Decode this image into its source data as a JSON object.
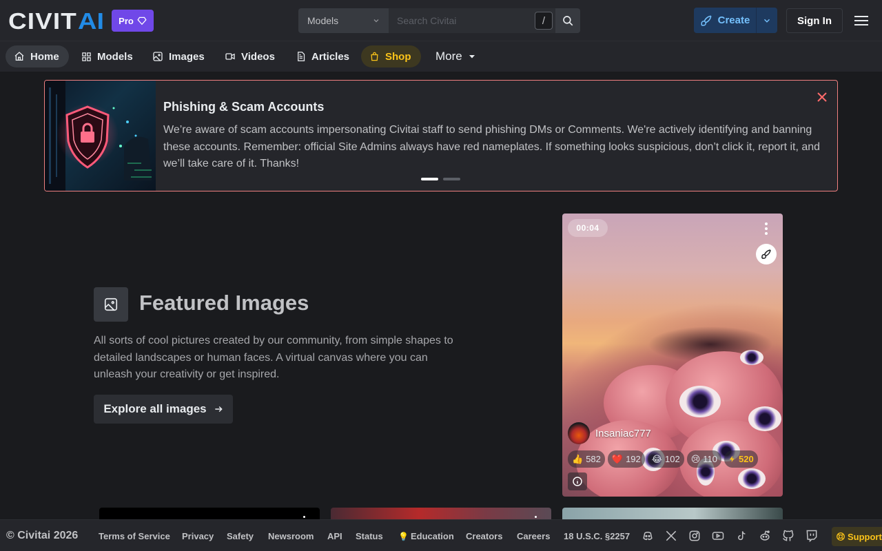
{
  "header": {
    "logo_text": "CIVITAI",
    "pro_label": "Pro",
    "search": {
      "category": "Models",
      "placeholder": "Search Civitai",
      "shortcut": "/"
    },
    "create_label": "Create",
    "signin_label": "Sign In"
  },
  "nav": {
    "items": [
      {
        "label": "Home",
        "icon": "home-icon"
      },
      {
        "label": "Models",
        "icon": "grid-icon"
      },
      {
        "label": "Images",
        "icon": "image-icon"
      },
      {
        "label": "Videos",
        "icon": "video-icon"
      },
      {
        "label": "Articles",
        "icon": "article-icon"
      },
      {
        "label": "Shop",
        "icon": "shopping-bag-icon"
      },
      {
        "label": "More",
        "icon": "caret-down-icon"
      }
    ]
  },
  "announcement": {
    "title": "Phishing & Scam Accounts",
    "body": "We’re aware of scam accounts impersonating Civitai staff to send phishing DMs or Comments. We're actively identifying and banning these accounts. Remember: official Site Admins always have red nameplates. If something looks suspicious, don’t click it, report it, and we’ll take care of it. Thanks!",
    "slide_count": 2,
    "active_slide": 1
  },
  "featured": {
    "title": "Featured Images",
    "description": "All sorts of cool pictures created by our community, from simple shapes to detailed landscapes or human faces. A virtual canvas where you can unleash your creativity or get inspired.",
    "explore_label": "Explore all images"
  },
  "card": {
    "duration": "00:04",
    "author": "Insaniac777",
    "reactions": {
      "like": "582",
      "heart": "192",
      "laugh": "102",
      "cry": "110",
      "buzz": "520"
    }
  },
  "footer": {
    "copyright": "© Civitai 2026",
    "links": [
      "Terms of Service",
      "Privacy",
      "Safety",
      "Newsroom",
      "API",
      "Status",
      "Education",
      "Creators",
      "Careers",
      "18 U.S.C. §2257"
    ],
    "support_label": "Support"
  },
  "colors": {
    "accent_blue": "#74c0fc",
    "pro_purple": "#7048e8",
    "shop_yellow": "#fcc419",
    "alert_border": "#f08080"
  }
}
